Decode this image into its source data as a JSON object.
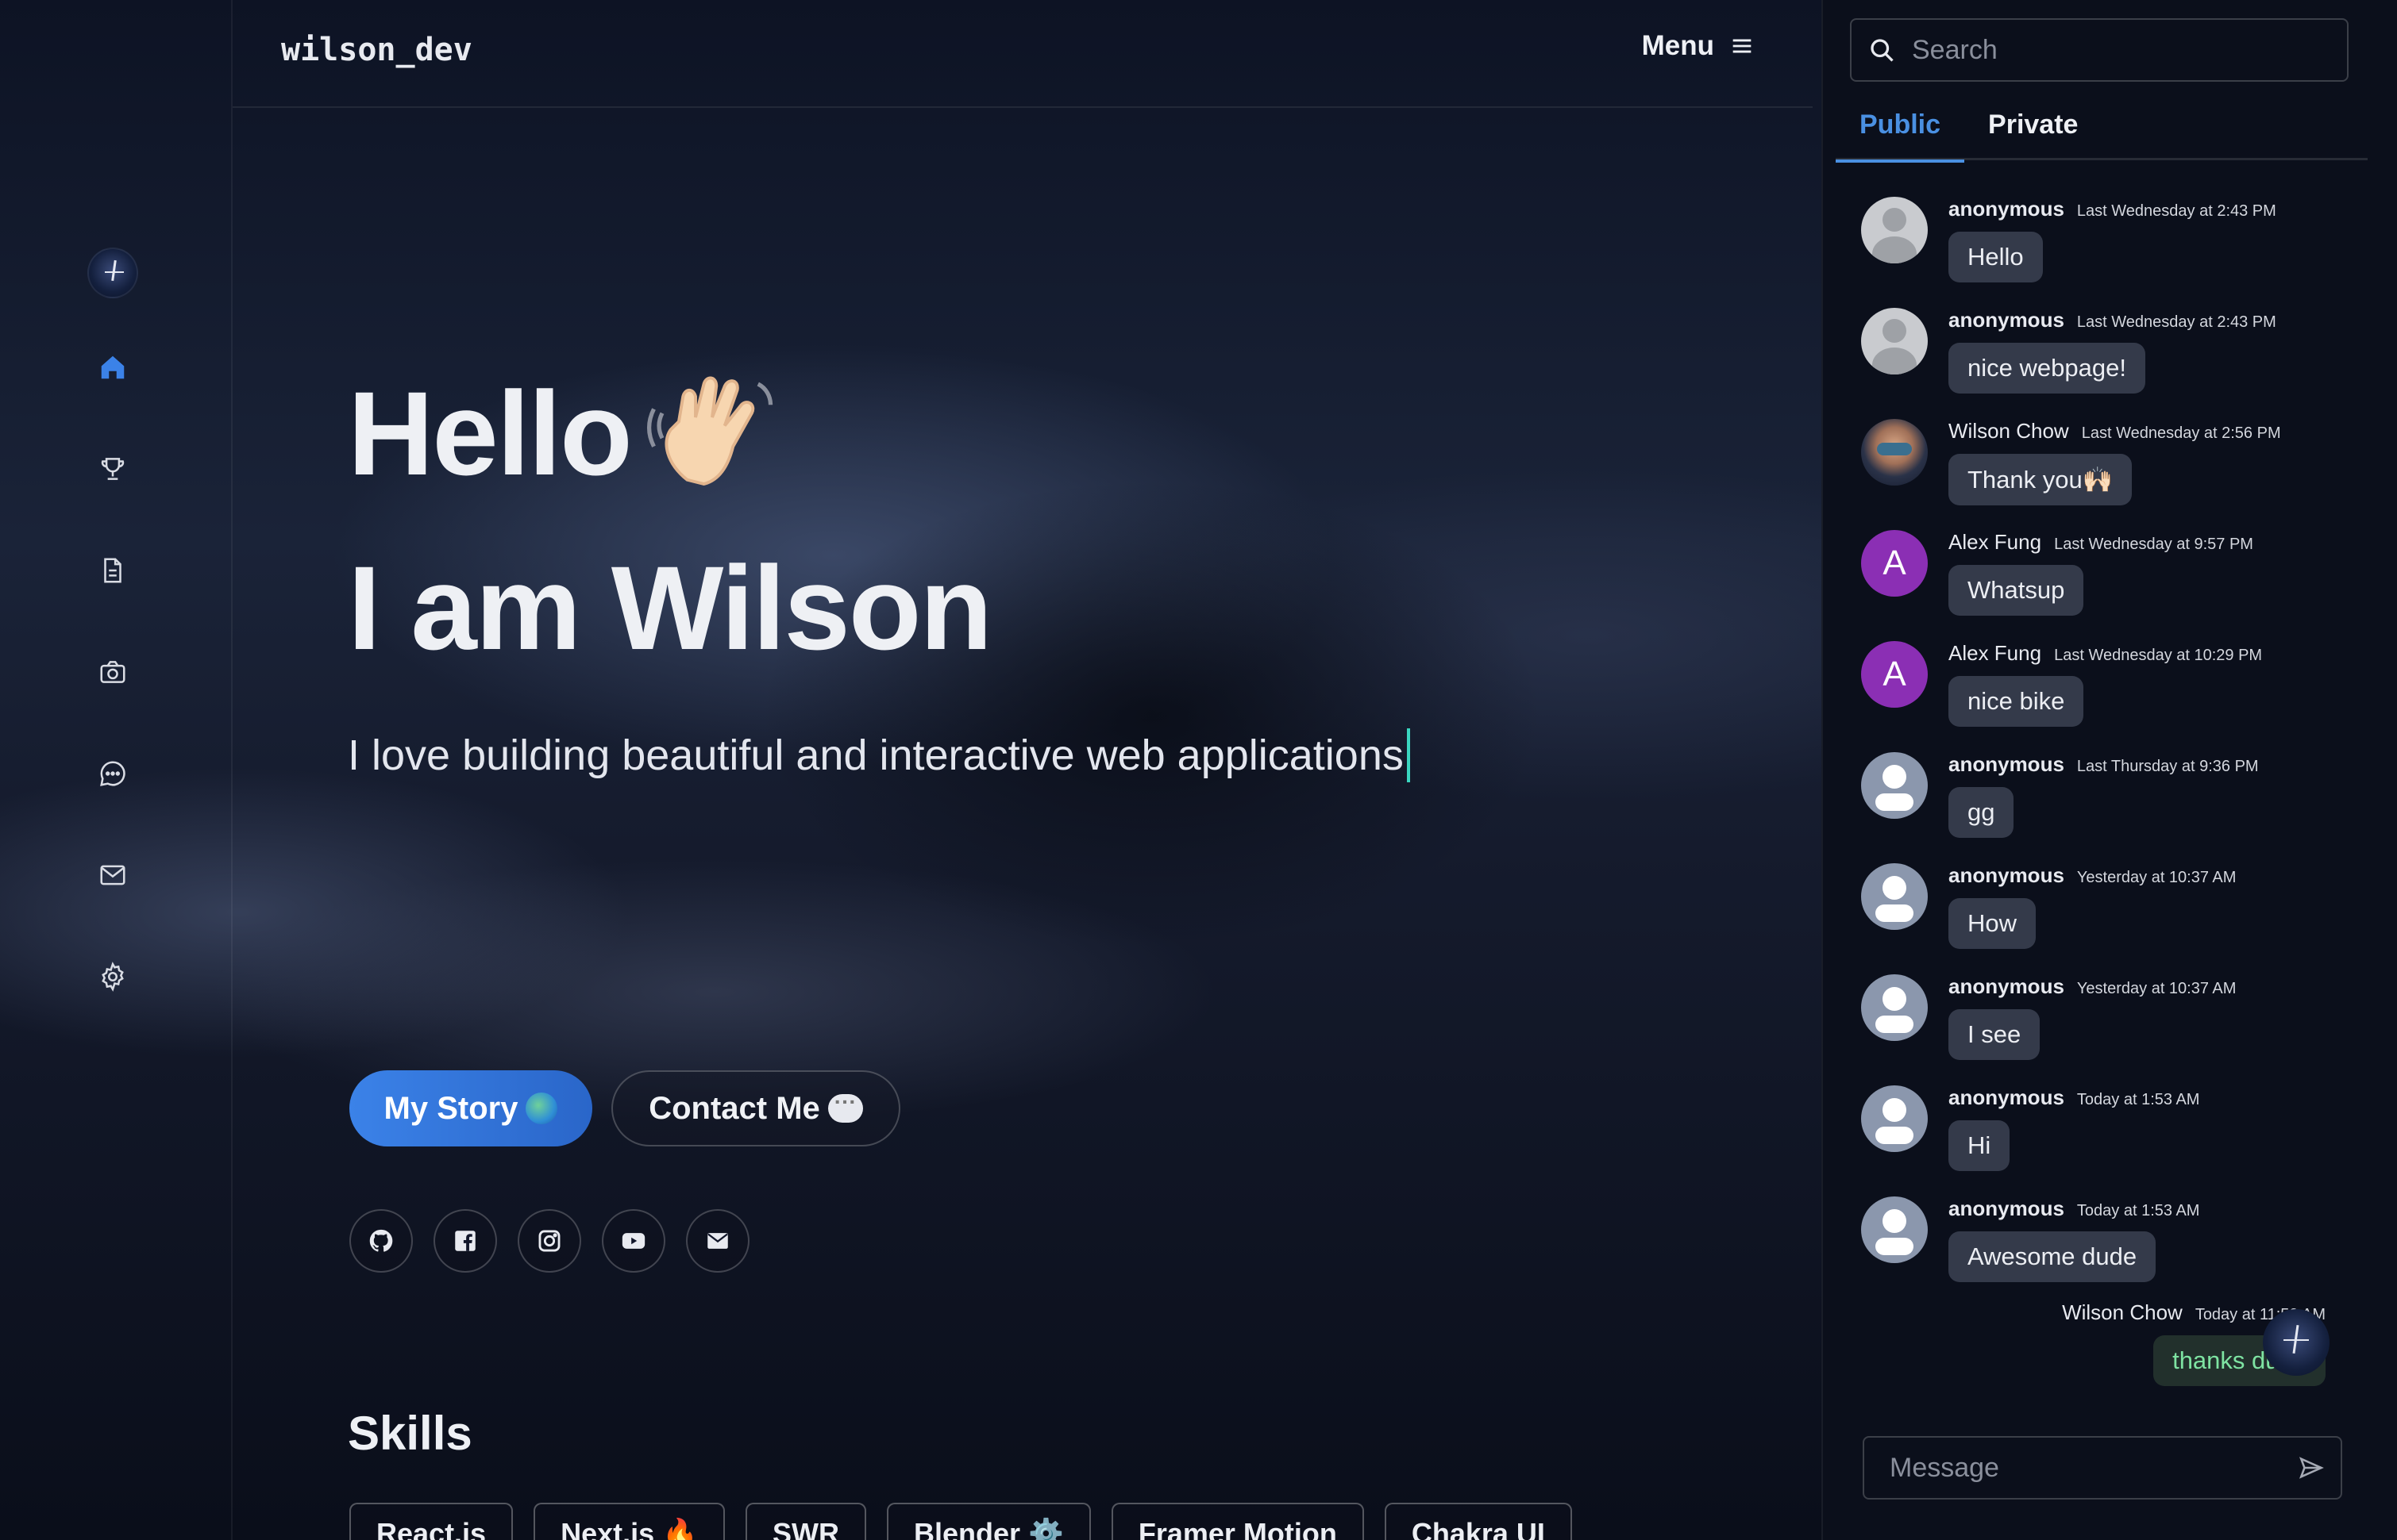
{
  "header": {
    "brand": "wilson_dev",
    "menu_label": "Menu"
  },
  "sidebar": {
    "items": [
      {
        "name": "home",
        "icon": "home-icon",
        "active": true
      },
      {
        "name": "achievements",
        "icon": "trophy-icon"
      },
      {
        "name": "resume",
        "icon": "document-icon"
      },
      {
        "name": "photos",
        "icon": "camera-icon"
      },
      {
        "name": "chat",
        "icon": "chat-bubble-icon"
      },
      {
        "name": "mail",
        "icon": "mail-icon"
      },
      {
        "name": "settings",
        "icon": "gear-icon"
      }
    ]
  },
  "hero": {
    "hello": "Hello",
    "iam": "I am Wilson",
    "tagline": "I love building beautiful and interactive web applications"
  },
  "actions": {
    "story_label": "My Story",
    "contact_label": "Contact Me"
  },
  "socials": [
    "github-icon",
    "facebook-icon",
    "instagram-icon",
    "youtube-icon",
    "mail-icon"
  ],
  "skills": {
    "title": "Skills",
    "items": [
      "React.js",
      "Next.js 🔥",
      "SWR",
      "Blender ⚙️",
      "Framer Motion",
      "Chakra UI"
    ]
  },
  "chat": {
    "search_placeholder": "Search",
    "tabs": [
      "Public",
      "Private"
    ],
    "active_tab": "Public",
    "messages": [
      {
        "name": "anonymous",
        "time": "Last Wednesday at 2:43 PM",
        "text": "Hello",
        "avatar": "anon-grey"
      },
      {
        "name": "anonymous",
        "time": "Last Wednesday at 2:43 PM",
        "text": "nice webpage!",
        "avatar": "anon-grey"
      },
      {
        "name": "Wilson Chow",
        "time": "Last Wednesday at 2:56 PM",
        "text": "Thank you🙌🏻",
        "avatar": "wilson"
      },
      {
        "name": "Alex Fung",
        "time": "Last Wednesday at 9:57 PM",
        "text": "Whatsup",
        "avatar": "letter",
        "letter": "A"
      },
      {
        "name": "Alex Fung",
        "time": "Last Wednesday at 10:29 PM",
        "text": "nice bike",
        "avatar": "letter",
        "letter": "A"
      },
      {
        "name": "anonymous",
        "time": "Last Thursday at 9:36 PM",
        "text": "gg",
        "avatar": "anon-blue"
      },
      {
        "name": "anonymous",
        "time": "Yesterday at 10:37 AM",
        "text": "How",
        "avatar": "anon-blue"
      },
      {
        "name": "anonymous",
        "time": "Yesterday at 10:37 AM",
        "text": "I see",
        "avatar": "anon-blue"
      },
      {
        "name": "anonymous",
        "time": "Today at 1:53 AM",
        "text": "Hi",
        "avatar": "anon-blue"
      },
      {
        "name": "anonymous",
        "time": "Today at 1:53 AM",
        "text": "Awesome dude",
        "avatar": "anon-blue"
      }
    ],
    "my_message": {
      "name": "Wilson Chow",
      "time": "Today at 11:52 AM",
      "text": "thanks dude"
    },
    "composer_placeholder": "Message"
  }
}
